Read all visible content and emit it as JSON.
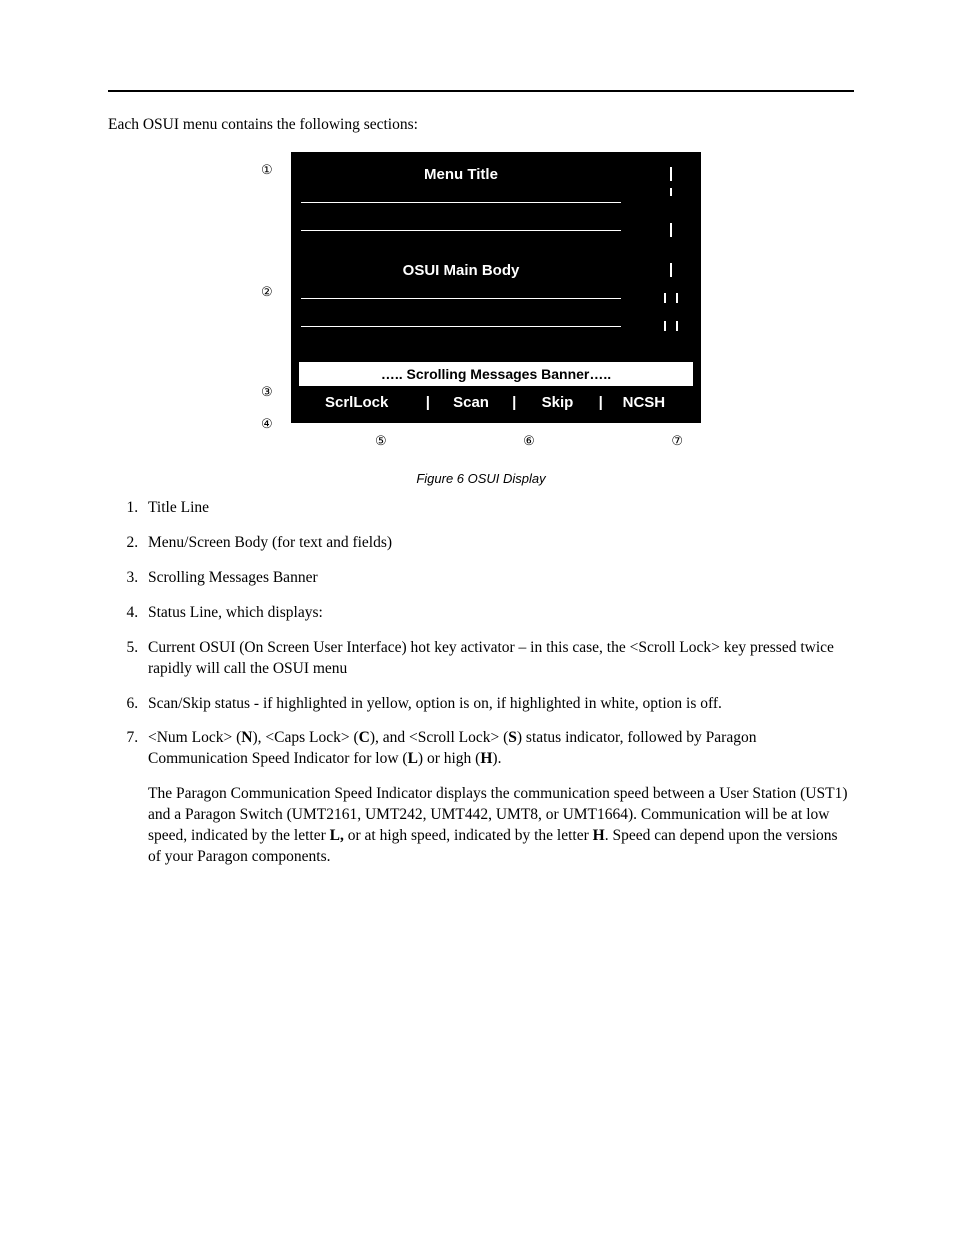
{
  "intro": "Each OSUI menu contains the following sections:",
  "figure": {
    "menu_title": "Menu  Title",
    "main_body": "OSUI  Main Body",
    "scrolling_banner": "….. Scrolling  Messages  Banner…..",
    "status": {
      "scrllock": "ScrlLock",
      "scan": "Scan",
      "skip": "Skip",
      "ncsh": "NCSH",
      "sep": "|"
    },
    "callouts": {
      "c1": "①",
      "c2": "②",
      "c3": "③",
      "c4": "④",
      "c5": "⑤",
      "c6": "⑥",
      "c7": "⑦"
    },
    "caption": "Figure 6  OSUI Display"
  },
  "list": {
    "i1": "Title Line",
    "i2": "Menu/Screen Body (for text and fields)",
    "i3": "Scrolling Messages Banner",
    "i4": "Status Line, which displays:",
    "i5": "Current OSUI (On Screen User Interface) hot key activator – in this case, the <Scroll Lock> key pressed twice rapidly will call the OSUI menu",
    "i6": "Scan/Skip status - if highlighted in yellow, option is on, if highlighted in white, option is off.",
    "i7": {
      "pre1": "<Num Lock> (",
      "N": "N",
      "mid1": "), <Caps Lock> (",
      "C": "C",
      "mid2": "), and <Scroll Lock> (",
      "S": "S",
      "mid3": ") status indicator, followed by Paragon Communication Speed Indicator for low (",
      "L": "L",
      "mid4": ") or high (",
      "H": "H",
      "post1": ").",
      "para2a": "The Paragon Communication Speed Indicator displays the communication speed between a User Station (UST1) and a Paragon Switch (UMT2161, UMT242, UMT442, UMT8, or UMT1664). Communication will be at low speed, indicated by the letter ",
      "L2": "L,",
      "para2b": " or at high speed, indicated by the letter ",
      "H2": "H",
      "para2c": ".  Speed can depend upon the versions of your Paragon components."
    }
  }
}
